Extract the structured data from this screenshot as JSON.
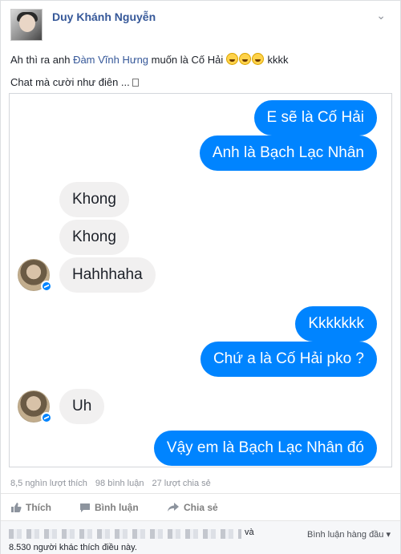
{
  "post": {
    "author": "Duy Khánh Nguyễn",
    "text_line1_pre": "Ah thì ra anh ",
    "text_line1_link": "Đàm Vĩnh Hưng",
    "text_line1_mid": " muốn là Cố Hải",
    "text_line1_post": " kkkk",
    "text_line2": "Chat mà cười như điên ..."
  },
  "chat": {
    "messages": [
      {
        "side": "sent",
        "text": "E sẽ là Cố Hải"
      },
      {
        "side": "sent",
        "text": "Anh là Bạch Lạc Nhân"
      },
      {
        "side": "recv",
        "text": "Khong"
      },
      {
        "side": "recv",
        "text": "Khong"
      },
      {
        "side": "recv",
        "text": "Hahhhaha"
      },
      {
        "side": "sent",
        "text": "Kkkkkkk"
      },
      {
        "side": "sent",
        "text": "Chứ a là Cố Hải pko ?"
      },
      {
        "side": "recv",
        "text": "Uh"
      },
      {
        "side": "sent",
        "text": "Vậy em là Bạch Lạc Nhân đó"
      }
    ],
    "sent_color": "#0084ff",
    "recv_color": "#f1f0f0"
  },
  "stats": {
    "likes": "8,5 nghìn lượt thích",
    "comments": "98 bình luận",
    "shares": "27 lượt chia sẻ"
  },
  "actions": {
    "like": "Thích",
    "comment": "Bình luận",
    "share": "Chia sẻ"
  },
  "footer": {
    "and": "và",
    "others": "8.530 người khác thích điều này.",
    "sort": "Bình luận hàng đầu ▾"
  }
}
